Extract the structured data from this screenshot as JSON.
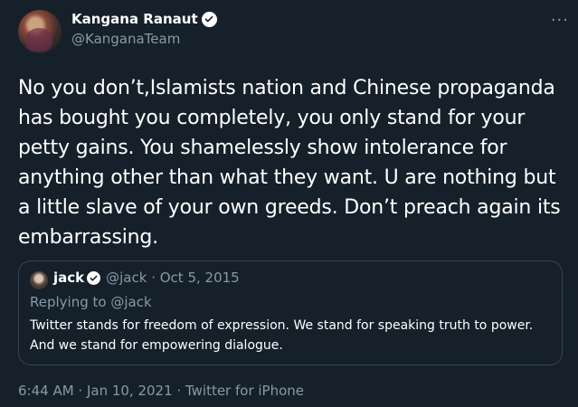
{
  "author": {
    "display_name": "Kangana Ranaut",
    "handle": "@KanganaTeam",
    "verified_icon": "verified-badge-icon"
  },
  "tweet": {
    "text": "No you don’t,Islamists nation and Chinese propaganda has bought you completely, you only stand for your petty gains. You shamelessly show intolerance for anything other than what they want. U are nothing but a little slave of your own greeds. Don’t preach again its embarrassing."
  },
  "quoted": {
    "display_name": "jack",
    "meta": "@jack · Oct 5, 2015",
    "replying_prefix": "Replying to ",
    "replying_to": "@jack",
    "text": "Twitter stands for freedom of expression. We stand for speaking truth to power. And we stand for empowering dialogue."
  },
  "footer": {
    "timestamp": "6:44 AM · Jan 10, 2021 · ",
    "app": "Twitter for iPhone"
  },
  "more_menu": "···",
  "colors": {
    "background": "#15202b",
    "secondary_text": "#8899a6",
    "border": "#38444d",
    "accent": "#1da1f2"
  }
}
